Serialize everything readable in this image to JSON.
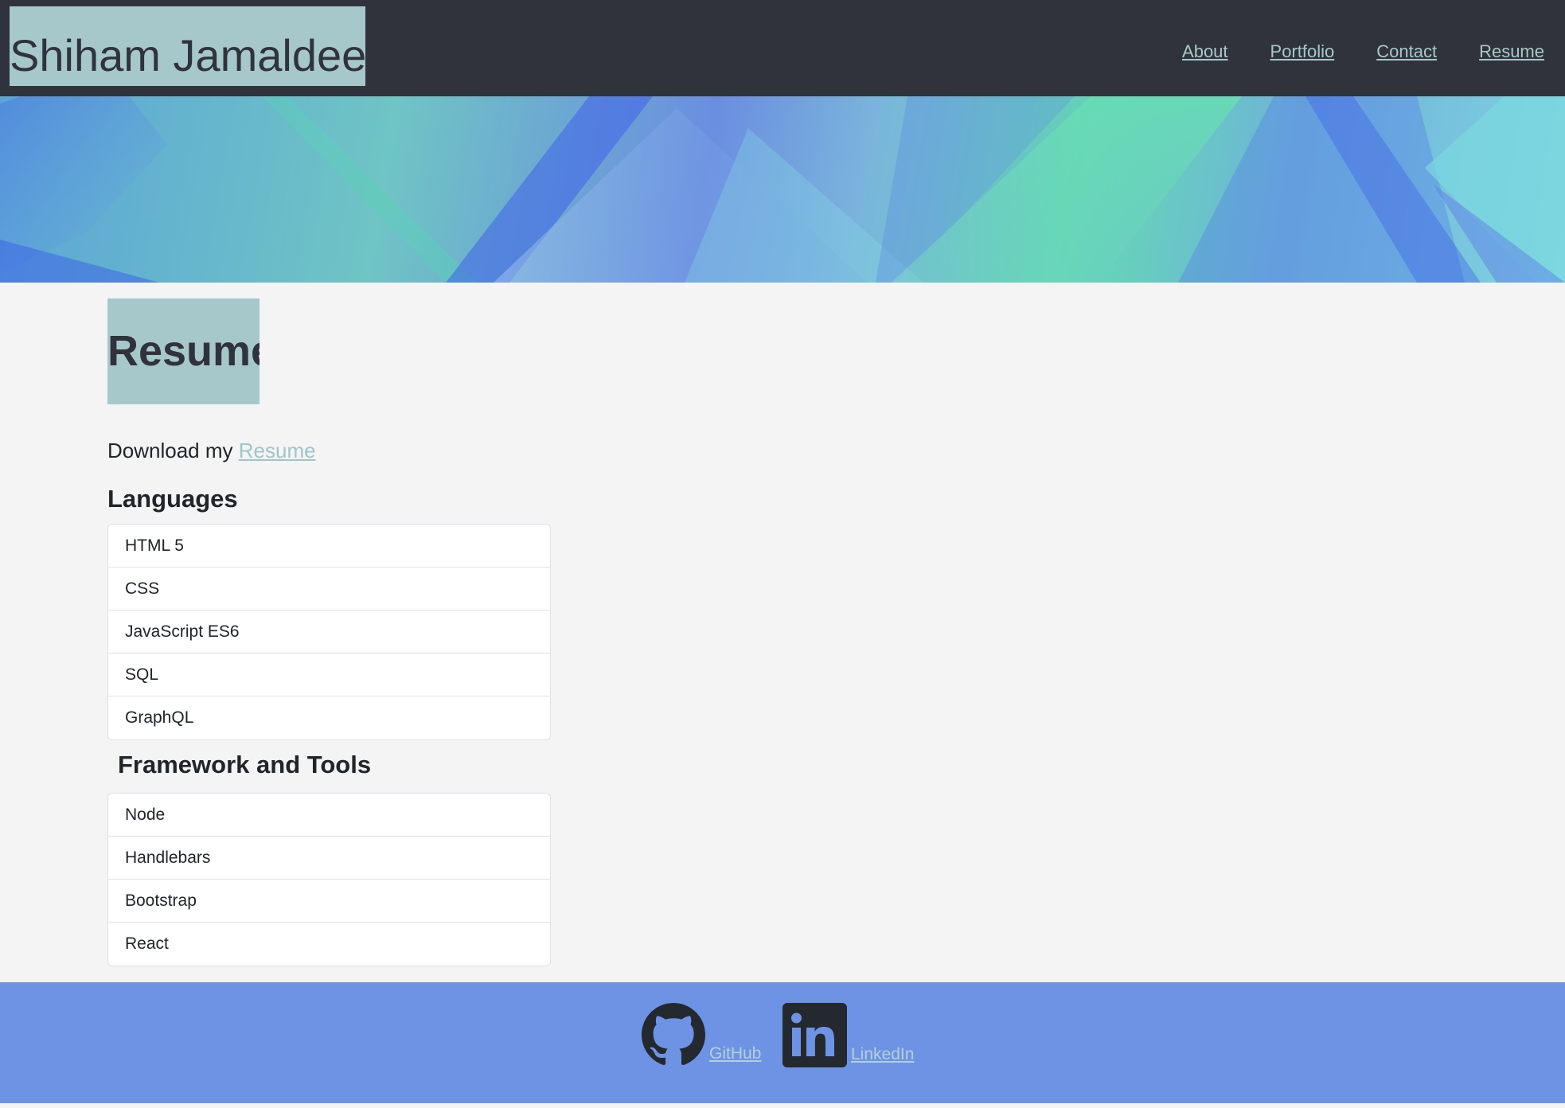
{
  "header": {
    "brand": "Shiham Jamaldeen",
    "nav": [
      "About",
      "Portfolio",
      "Contact",
      "Resume"
    ]
  },
  "main": {
    "title": "Resume",
    "download_text": "Download my",
    "download_link": "Resume",
    "languages": {
      "title": "Languages",
      "items": [
        "HTML 5",
        "CSS",
        "JavaScript ES6",
        "SQL",
        "GraphQL"
      ]
    },
    "tools": {
      "title": "Framework and Tools",
      "items": [
        "Node",
        "Handlebars",
        "Bootstrap",
        "React"
      ]
    }
  },
  "footer": {
    "github_label": "GitHub",
    "linkedin_label": "LinkedIn"
  },
  "colors": {
    "header_bg": "#30333b",
    "accent": "#a7c8ca",
    "footer_bg": "#6f93e4"
  },
  "icons": [
    "github-icon",
    "linkedin-icon"
  ]
}
